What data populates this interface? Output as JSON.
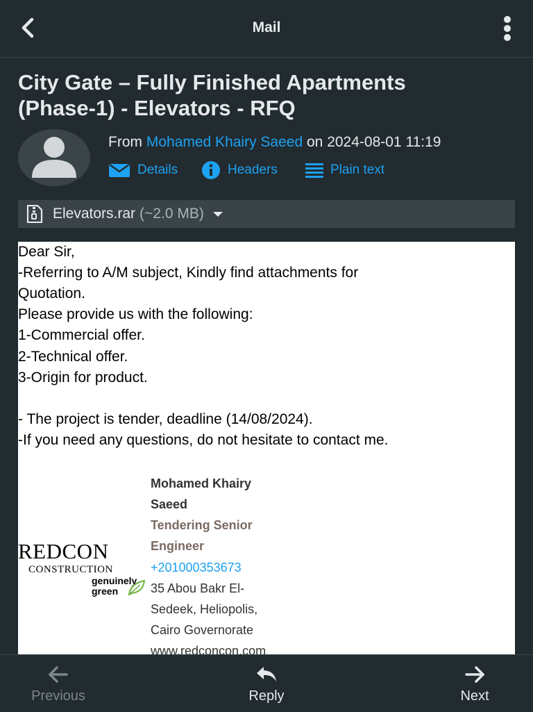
{
  "header": {
    "title": "Mail",
    "back_icon": "back-arrow-icon",
    "menu_icon": "more-vertical-icon"
  },
  "message": {
    "subject_line1": "City Gate – Fully Finished Apartments",
    "subject_line2": "(Phase-1) - Elevators - RFQ",
    "from_prefix": "From",
    "sender": "Mohamed Khairy Saeed",
    "date_text": "on 2024-08-01 11:19",
    "actions": {
      "details": "Details",
      "headers": "Headers",
      "plain_text": "Plain text"
    },
    "attachment": {
      "name": "Elevators.rar",
      "size": "(~2.0 MB)"
    },
    "body_lines": [
      "Dear Sir,",
      "-Referring to A/M subject, Kindly find attachments for",
      "Quotation.",
      "Please provide us with the following:",
      "1-Commercial offer.",
      "2-Technical offer.",
      "3-Origin for product.",
      "- The project is tender, deadline (14/08/2024).",
      "-If you need any questions, do not hesitate to contact me."
    ],
    "logo": {
      "main": "REDCON",
      "sub": "CONSTRUCTION",
      "tag1": "genuinely",
      "tag2": "green"
    },
    "signature": {
      "name1": "Mohamed Khairy",
      "name2": "Saeed",
      "title1": "Tendering Senior",
      "title2": "Engineer",
      "phone": "+201000353673",
      "addr1": "35 Abou Bakr El-",
      "addr2": "Sedeek, Heliopolis,",
      "addr3": "Cairo Governorate",
      "web": "www.redconcon.com"
    }
  },
  "footer": {
    "previous": "Previous",
    "reply": "Reply",
    "next": "Next"
  },
  "colors": {
    "background": "#222b2f",
    "accent": "#1da1f2",
    "attachment_bar": "#3a4448"
  }
}
